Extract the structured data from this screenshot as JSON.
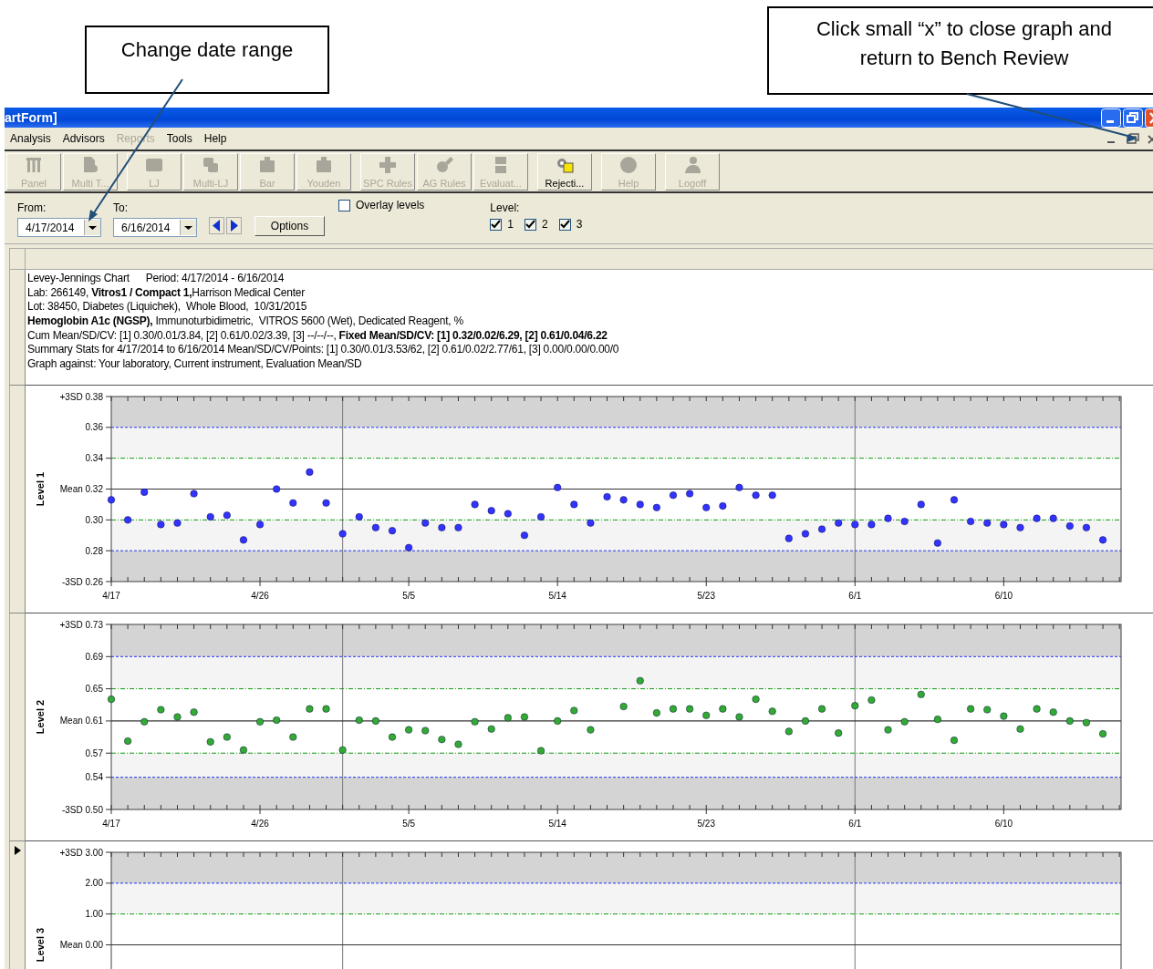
{
  "callouts": [
    {
      "text": "Change date range"
    },
    {
      "text": "Click small “x” to close graph and return to Bench Review"
    }
  ],
  "window": {
    "title": "artForm]"
  },
  "menu": [
    {
      "label": "Analysis",
      "disabled": false
    },
    {
      "label": "Advisors",
      "disabled": false
    },
    {
      "label": "Reports",
      "disabled": true
    },
    {
      "label": "Tools",
      "disabled": false
    },
    {
      "label": "Help",
      "disabled": false
    }
  ],
  "toolbar": [
    [
      {
        "label": "Panel",
        "disabled": true
      },
      {
        "label": "Multi T...",
        "disabled": true
      }
    ],
    [
      {
        "label": "LJ",
        "disabled": true
      },
      {
        "label": "Multi-LJ",
        "disabled": true
      },
      {
        "label": "Bar",
        "disabled": true
      },
      {
        "label": "Youden",
        "disabled": true
      }
    ],
    [
      {
        "label": "SPC Rules",
        "disabled": true
      },
      {
        "label": "AG Rules",
        "disabled": true
      },
      {
        "label": "Evaluat...",
        "disabled": true
      }
    ],
    [
      {
        "label": "Rejecti...",
        "disabled": false
      }
    ],
    [
      {
        "label": "Help",
        "disabled": true
      }
    ],
    [
      {
        "label": "Logoff",
        "disabled": true
      }
    ]
  ],
  "filters": {
    "from_label": "From:",
    "from": "4/17/2014",
    "to_label": "To:",
    "to": "6/16/2014",
    "options_button": "Options",
    "overlay": {
      "label": "Overlay levels",
      "checked": false
    },
    "level_label": "Level:",
    "levels": [
      {
        "label": "1",
        "checked": true
      },
      {
        "label": "2",
        "checked": true
      },
      {
        "label": "3",
        "checked": true
      }
    ]
  },
  "report": {
    "title": "Levey-Jennings Chart",
    "period": "Period: 4/17/2014 - 6/16/2014",
    "lines": [
      "Lab: 266149, **Vitros1 / Compact 1,**Harrison Medical Center",
      "Lot: 38450, Diabetes (Liquichek),  Whole Blood,  10/31/2015",
      "**Hemoglobin A1c (NGSP),** Immunoturbidimetric,  VITROS 5600 (Wet), Dedicated Reagent, %",
      "Cum Mean/SD/CV: [1] 0.30/0.01/3.84, [2] 0.61/0.02/3.39, [3] --/--/--, **Fixed Mean/SD/CV: [1] 0.32/0.02/6.29, [2] 0.61/0.04/6.22**",
      "Summary Stats for 4/17/2014 to 6/16/2014 Mean/SD/CV/Points: [1] 0.30/0.01/3.53/62, [2] 0.61/0.02/2.77/61, [3] 0.00/0.00/0.00/0",
      "Graph against: Your laboratory, Current instrument, Evaluation Mean/SD"
    ]
  },
  "charts": [
    {
      "current": false,
      "chart_data": {
        "type": "scatter",
        "ylabel": "Level 1",
        "ylim": [
          0.26,
          0.38
        ],
        "grid": true,
        "ref_lines": [
          {
            "axis": "y",
            "value": 0.32
          }
        ],
        "categories": [
          "4/17",
          null,
          null,
          null,
          null,
          null,
          null,
          null,
          null,
          "4/26",
          null,
          null,
          null,
          null,
          null,
          null,
          null,
          null,
          "5/5",
          null,
          null,
          null,
          null,
          null,
          null,
          null,
          null,
          "5/14",
          null,
          null,
          null,
          null,
          null,
          null,
          null,
          null,
          "5/23",
          null,
          null,
          null,
          null,
          null,
          null,
          null,
          null,
          "6/1",
          null,
          null,
          null,
          null,
          null,
          null,
          null,
          null,
          "6/10",
          null,
          null,
          null,
          null,
          null,
          null
        ],
        "yticks": [
          {
            "value": 0.38,
            "label": "+3SD 0.38"
          },
          {
            "value": 0.36,
            "label": "0.36"
          },
          {
            "value": 0.34,
            "label": "0.34"
          },
          {
            "value": 0.32,
            "label": "Mean 0.32"
          },
          {
            "value": 0.3,
            "label": "0.30"
          },
          {
            "value": 0.28,
            "label": "0.28"
          },
          {
            "value": 0.26,
            "label": "-3SD 0.26"
          }
        ],
        "series": [
          {
            "color": "#3333ff",
            "values": [
              0.313,
              0.3,
              0.318,
              0.297,
              0.298,
              0.317,
              0.302,
              0.303,
              0.287,
              0.297,
              0.32,
              0.311,
              0.331,
              0.311,
              0.291,
              0.302,
              0.295,
              0.293,
              0.282,
              0.298,
              0.295,
              0.295,
              0.31,
              0.306,
              0.304,
              0.29,
              0.302,
              0.321,
              0.31,
              0.298,
              0.315,
              0.313,
              0.31,
              0.308,
              0.316,
              0.317,
              0.308,
              0.309,
              0.321,
              0.316,
              0.316,
              0.288,
              0.291,
              0.294,
              0.298,
              0.297,
              0.297,
              0.301,
              0.299,
              0.31,
              0.285,
              0.313,
              0.299,
              0.298,
              0.297,
              0.295,
              0.301,
              0.301,
              0.296,
              0.295,
              0.287
            ]
          }
        ]
      }
    },
    {
      "current": false,
      "chart_data": {
        "type": "scatter",
        "ylabel": "Level 2",
        "ylim": [
          0.5,
          0.73
        ],
        "grid": true,
        "ref_lines": [
          {
            "axis": "y",
            "value": 0.61
          }
        ],
        "categories": [
          "4/17",
          null,
          null,
          null,
          null,
          null,
          null,
          null,
          null,
          "4/26",
          null,
          null,
          null,
          null,
          null,
          null,
          null,
          null,
          "5/5",
          null,
          null,
          null,
          null,
          null,
          null,
          null,
          null,
          "5/14",
          null,
          null,
          null,
          null,
          null,
          null,
          null,
          null,
          "5/23",
          null,
          null,
          null,
          null,
          null,
          null,
          null,
          null,
          "6/1",
          null,
          null,
          null,
          null,
          null,
          null,
          null,
          null,
          "6/10",
          null,
          null,
          null,
          null,
          null,
          null
        ],
        "yticks": [
          {
            "value": 0.73,
            "label": "+3SD 0.73"
          },
          {
            "value": 0.69,
            "label": "0.69"
          },
          {
            "value": 0.65,
            "label": "0.65"
          },
          {
            "value": 0.61,
            "label": "Mean 0.61"
          },
          {
            "value": 0.57,
            "label": "0.57"
          },
          {
            "value": 0.54,
            "label": "0.54"
          },
          {
            "value": 0.5,
            "label": "-3SD 0.50"
          }
        ],
        "series": [
          {
            "color": "#33aa33",
            "values": [
              0.637,
              0.585,
              0.609,
              0.624,
              0.615,
              0.621,
              0.584,
              0.59,
              0.574,
              0.609,
              0.611,
              0.59,
              0.625,
              0.625,
              0.574,
              0.611,
              0.61,
              0.59,
              0.599,
              0.598,
              0.587,
              0.581,
              0.609,
              0.6,
              0.614,
              0.615,
              0.573,
              0.61,
              0.623,
              0.599,
              null,
              0.628,
              0.66,
              0.62,
              0.625,
              0.625,
              0.617,
              0.625,
              0.615,
              0.637,
              0.622,
              0.597,
              0.61,
              0.625,
              0.595,
              0.629,
              0.636,
              0.599,
              0.609,
              0.643,
              0.612,
              0.586,
              0.625,
              0.624,
              0.616,
              0.6,
              0.625,
              0.621,
              0.61,
              0.608,
              0.594
            ]
          }
        ]
      }
    },
    {
      "current": true,
      "panel": {
        "ylabel": "Level 3",
        "tick_labels": [
          "+3SD 3.00",
          "2.00",
          "1.00",
          "Mean 0.00"
        ]
      }
    }
  ]
}
